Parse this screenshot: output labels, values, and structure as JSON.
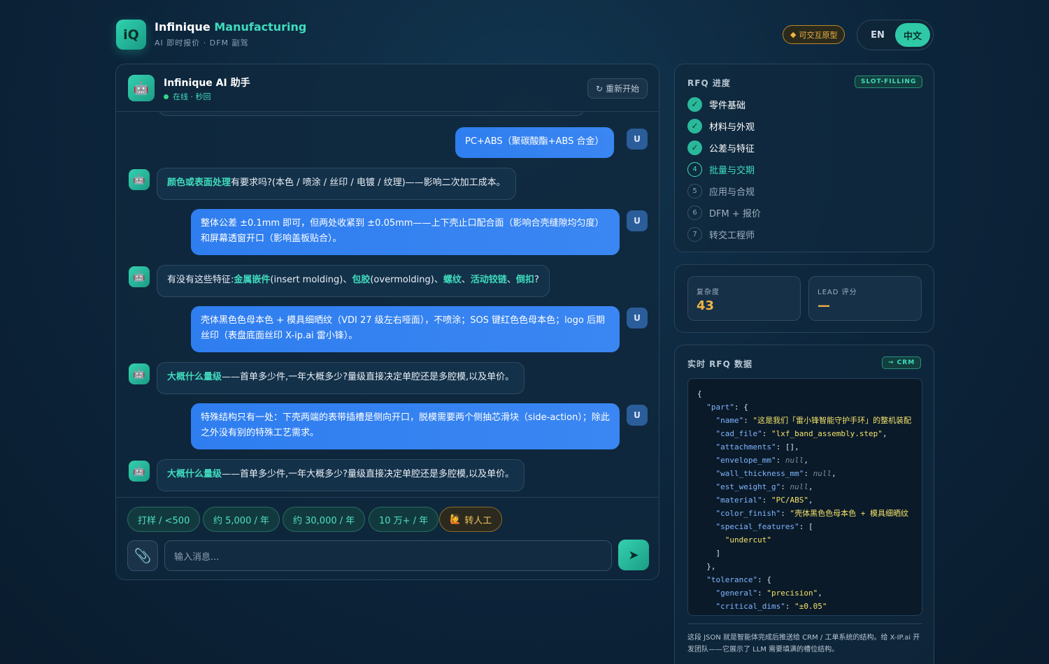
{
  "header": {
    "logo_text": "iQ",
    "brand_part1": "Infinique",
    "brand_part2": "Manufacturing",
    "subtitle": "AI 即时报价 · DFM 副驾",
    "prototype_badge": "可交互原型",
    "lang_en": "EN",
    "lang_zh": "中文",
    "active_lang": "中文"
  },
  "chat": {
    "title": "Infinique AI 助手",
    "status": "在线 · 秒回",
    "restart_label": "重新开始",
    "user_avatar": "U",
    "messages": [
      {
        "role": "user",
        "text": "PC+ABS（聚碳酸酯+ABS 合金）"
      },
      {
        "role": "bot",
        "hl": "颜色或表面处理",
        "text": "有要求吗?(本色 / 喷涂 / 丝印 / 电镀 / 纹理)——影响二次加工成本。"
      },
      {
        "role": "user",
        "text": "整体公差 ±0.1mm 即可，但两处收紧到 ±0.05mm——上下壳止口配合面（影响合壳缝隙均匀度）和屏幕透窗开口（影响盖板贴合）。"
      },
      {
        "role": "bot",
        "p1": "有没有这些特征:",
        "h1": "金属嵌件",
        "p2": "(insert molding)、",
        "h2": "包胶",
        "p3": "(overmolding)、",
        "h3": "螺纹",
        "p4": "、",
        "h4": "活动铰链",
        "p5": "、",
        "h5": "倒扣",
        "p6": "?"
      },
      {
        "role": "user",
        "text": "壳体黑色色母本色 + 模具细晒纹（VDI 27 级左右哑面），不喷涂；SOS 键红色色母本色；logo 后期丝印（表盘底面丝印 X-ip.ai 雷小锋）。"
      },
      {
        "role": "bot",
        "hl": "大概什么量级",
        "text": "——首单多少件,一年大概多少?量级直接决定单腔还是多腔模,以及单价。"
      },
      {
        "role": "user",
        "text": "特殊结构只有一处：下壳两端的表带插槽是侧向开口，脱模需要两个侧抽芯滑块（side-action）；除此之外没有别的特殊工艺需求。"
      },
      {
        "role": "bot",
        "hl": "大概什么量级",
        "text": "——首单多少件,一年大概多少?量级直接决定单腔还是多腔模,以及单价。"
      }
    ],
    "quick_replies": [
      "打样 / <500",
      "约 5,000 / 年",
      "约 30,000 / 年",
      "10 万+ / 年"
    ],
    "human_label": "转人工",
    "input_placeholder": "输入消息..."
  },
  "rfq": {
    "title": "RFQ 进度",
    "tag": "SLOT-FILLING",
    "steps": [
      {
        "n": "1",
        "label": "零件基础",
        "state": "done"
      },
      {
        "n": "2",
        "label": "材料与外观",
        "state": "done"
      },
      {
        "n": "3",
        "label": "公差与特征",
        "state": "done"
      },
      {
        "n": "4",
        "label": "批量与交期",
        "state": "current"
      },
      {
        "n": "5",
        "label": "应用与合规",
        "state": "todo"
      },
      {
        "n": "6",
        "label": "DFM + 报价",
        "state": "todo"
      },
      {
        "n": "7",
        "label": "转交工程师",
        "state": "todo"
      }
    ]
  },
  "stats": {
    "complexity_label": "复杂度",
    "complexity_value": "43",
    "lead_label": "LEAD 评分",
    "lead_value": "—"
  },
  "live": {
    "title": "实时 RFQ 数据",
    "tag": "→ CRM",
    "json_keys": {
      "part": "\"part\"",
      "name": "\"name\"",
      "cad_file": "\"cad_file\"",
      "attachments": "\"attachments\"",
      "envelope_mm": "\"envelope_mm\"",
      "wall_thickness_mm": "\"wall_thickness_mm\"",
      "est_weight_g": "\"est_weight_g\"",
      "material": "\"material\"",
      "color_finish": "\"color_finish\"",
      "special_features": "\"special_features\"",
      "tolerance": "\"tolerance\"",
      "general": "\"general\"",
      "critical_dims": "\"critical_dims\""
    },
    "json_values": {
      "name": "\"这是我们「雷小锋智能守护手环」的整机装配",
      "cad_file": "\"lxf_band_assembly.step\"",
      "attachments": "[]",
      "envelope_mm": "null",
      "wall_thickness_mm": "null",
      "est_weight_g": "null",
      "material": "\"PC/ABS\"",
      "color_finish": "\"壳体黑色色母本色 + 模具细晒纹",
      "feature_0": "\"undercut\"",
      "general": "\"precision\"",
      "critical_dims": "\"±0.05\""
    },
    "note": "这段 JSON 就是智能体完成后推送给 CRM / 工单系统的结构。给 X-IP.ai 开发团队——它展示了 LLM 需要填满的槽位结构。"
  },
  "colors": {
    "accent": "#3fdcbc",
    "user_bubble": "#2f7ef0",
    "badge": "#f1b443"
  }
}
